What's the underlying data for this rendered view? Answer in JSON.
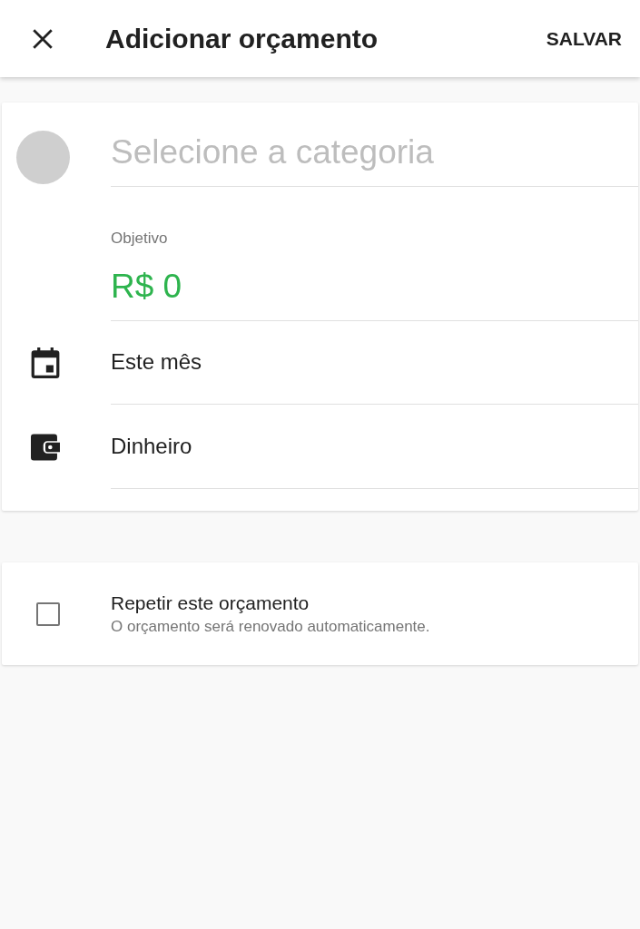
{
  "app_bar": {
    "title": "Adicionar orçamento",
    "action": "SALVAR"
  },
  "category_field": {
    "placeholder": "Selecione a categoria"
  },
  "goal_field": {
    "label": "Objetivo",
    "value": "R$ 0"
  },
  "rows": [
    {
      "kind": "calendar",
      "value": "Este mês"
    },
    {
      "kind": "wallet",
      "value": "Dinheiro"
    }
  ],
  "repeat": {
    "title": "Repetir este orçamento",
    "subtitle": "O orçamento será renovado automaticamente.",
    "checked": false
  }
}
